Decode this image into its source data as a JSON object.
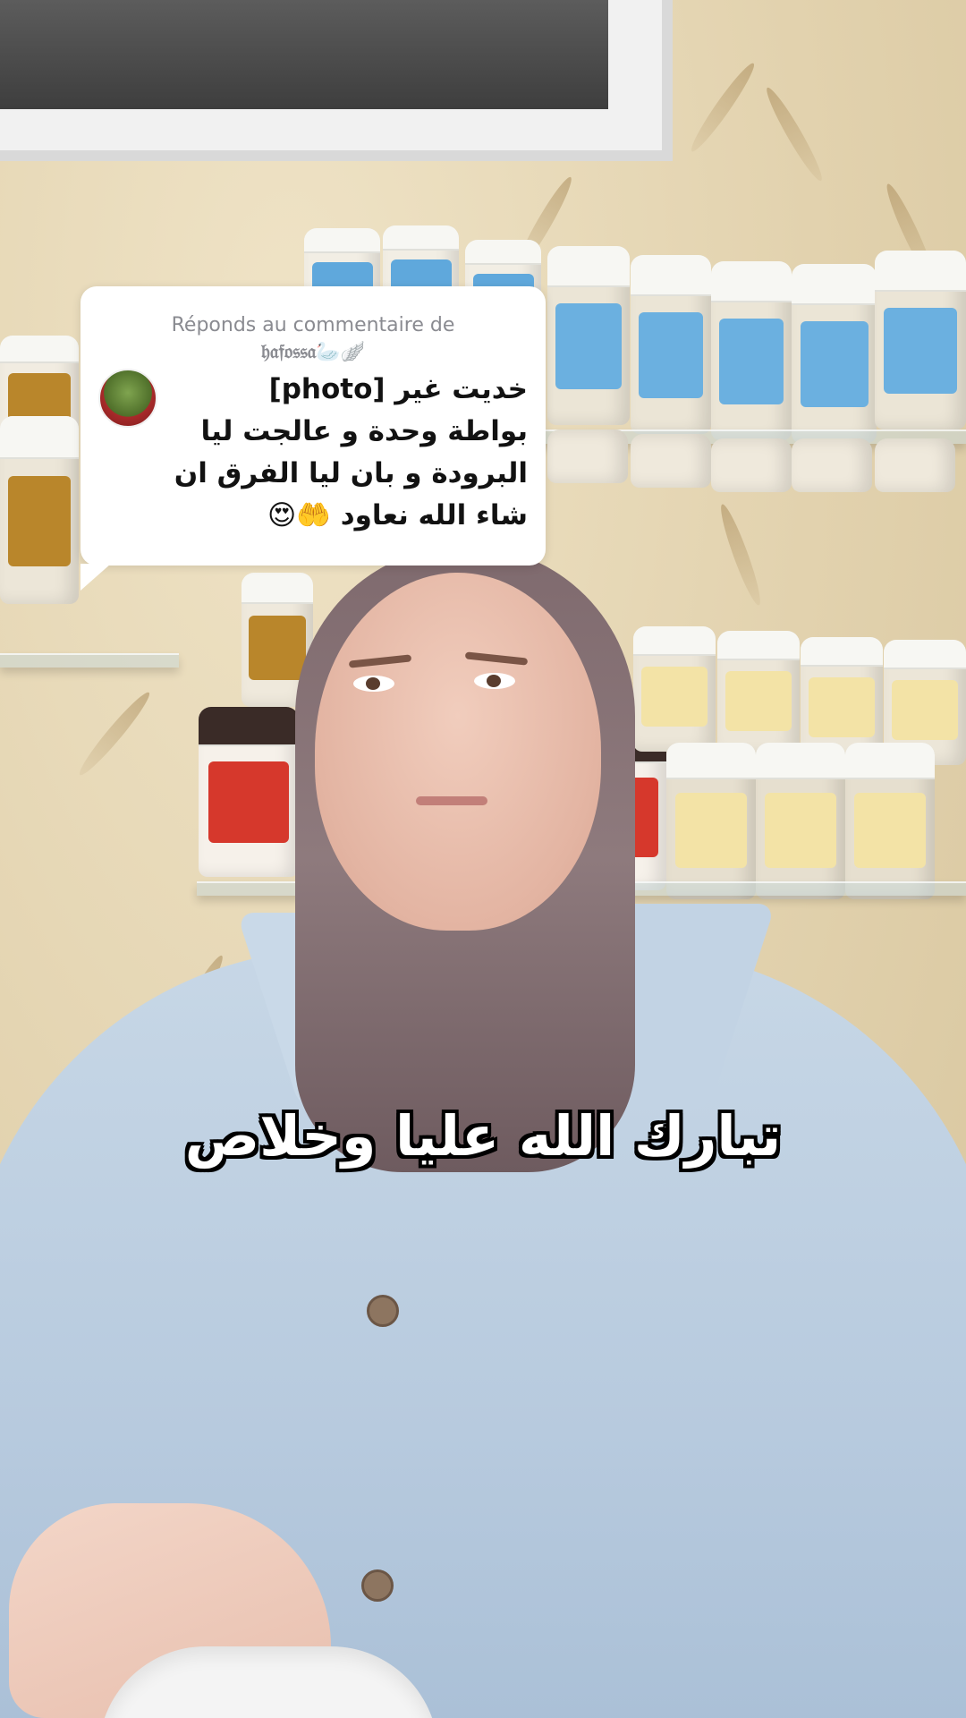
{
  "reply_card": {
    "header": "Réponds au commentaire de",
    "username": "𝔥𝔞𝔣𝔬𝔰𝔰𝔞🦢🪽",
    "lines": [
      "خديت غير [photo]",
      "بواطة وحدة و عالجت ليا",
      "البرودة و بان ليا الفرق ان",
      "شاء الله نعاود 🤲😍"
    ]
  },
  "caption": {
    "text": "تبارك الله عليا وخلاص"
  }
}
